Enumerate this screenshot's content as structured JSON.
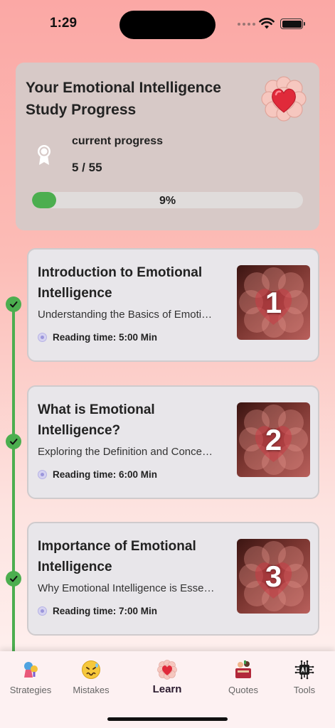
{
  "status_bar": {
    "time": "1:29"
  },
  "progress_card": {
    "title": "Your Emotional Intelligence Study Progress",
    "current_label": "current progress",
    "current_value": "5 / 55",
    "percent_text": "9%",
    "percent_fraction": 0.09,
    "icon": "brain-heart-icon"
  },
  "lessons": [
    {
      "number": "1",
      "title": "Introduction to Emotional Intelligence",
      "description": "Understanding the Basics of Emoti…",
      "reading_time": "Reading time: 5:00 Min",
      "completed": true
    },
    {
      "number": "2",
      "title": "What is Emotional Intelligence?",
      "description": "Exploring the Definition and Conce…",
      "reading_time": "Reading time: 6:00 Min",
      "completed": true
    },
    {
      "number": "3",
      "title": "Importance of Emotional Intelligence",
      "description": "Why Emotional Intelligence is Esse…",
      "reading_time": "Reading time: 7:00 Min",
      "completed": true
    }
  ],
  "nav": {
    "items": [
      {
        "label": "Strategies",
        "icon": "strategies-icon"
      },
      {
        "label": "Mistakes",
        "icon": "mistakes-face-icon"
      },
      {
        "label": "Learn",
        "icon": "brain-heart-icon",
        "active": true
      },
      {
        "label": "Quotes",
        "icon": "quotes-icon"
      },
      {
        "label": "Tools",
        "icon": "ai-chip-icon"
      }
    ]
  },
  "colors": {
    "accent_green": "#4cae4f",
    "card_bg": "#d7c9c7",
    "lesson_bg": "#e8e6ea"
  }
}
